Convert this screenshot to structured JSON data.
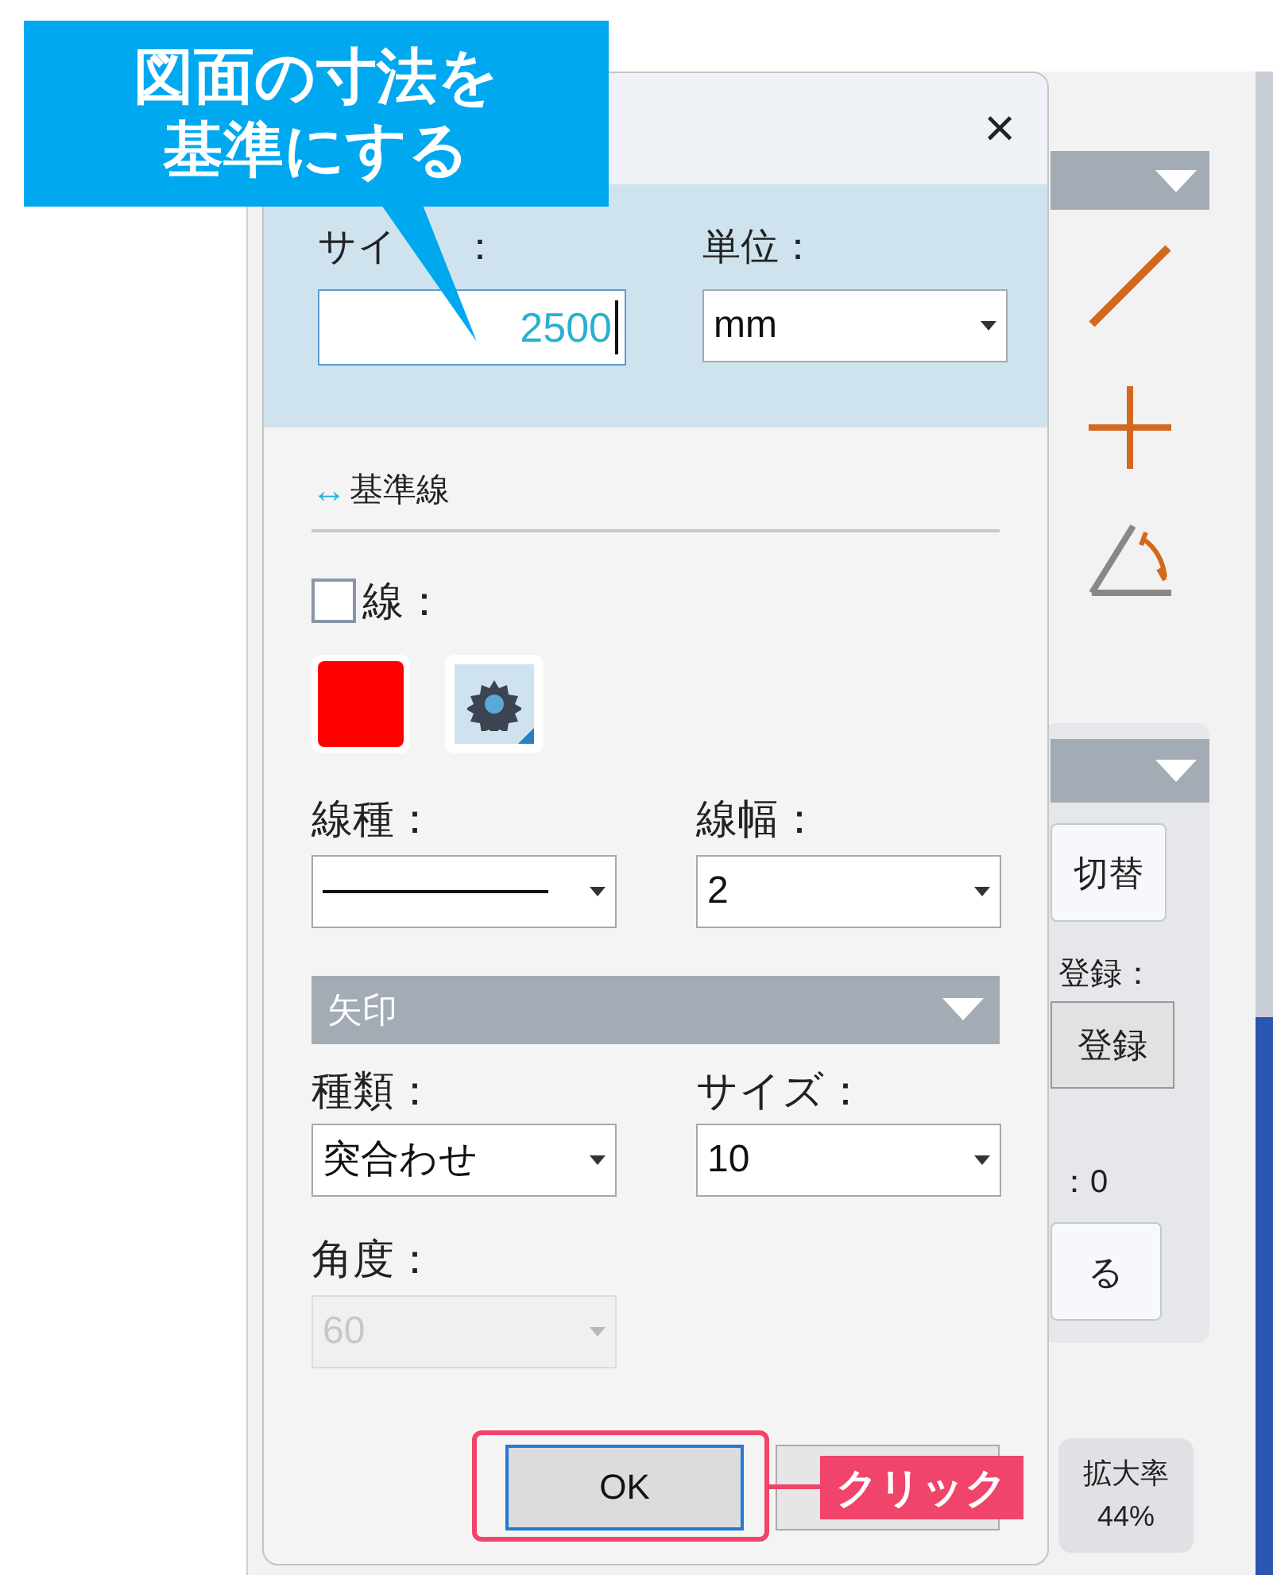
{
  "callout": {
    "lines": [
      "図面の寸法を",
      "基準にする"
    ]
  },
  "dialog": {
    "close": "×",
    "size_label": "サイ",
    "size_colon": "：",
    "size_value": "2500",
    "unit_label": "単位：",
    "unit_value": "mm",
    "baseline": {
      "icon": "↔",
      "title": "基準線"
    },
    "line_checkbox": {
      "label": "線：",
      "checked": false
    },
    "swatch": {
      "color": "#ff0000"
    },
    "line_type_label": "線種：",
    "line_width_label": "線幅：",
    "line_width_value": "2",
    "arrow_section": {
      "title": "矢印"
    },
    "kind_label": "種類：",
    "kind_value": "突合わせ",
    "arrow_size_label": "サイズ：",
    "arrow_size_value": "10",
    "angle_label": "角度：",
    "angle": {
      "value": "60",
      "disabled": true
    },
    "ok_button": "OK"
  },
  "annotation_tag": "クリック",
  "background_panel": {
    "switch_button": "切替",
    "register_label": "登録：",
    "register_button": "登録",
    "count": "：0",
    "button_4": "る",
    "zoom_label": "拡大率",
    "zoom_value": "44%"
  }
}
